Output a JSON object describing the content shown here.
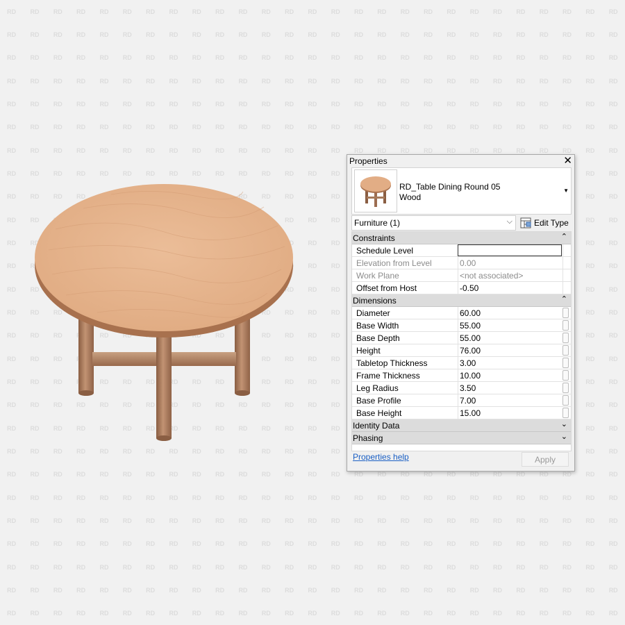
{
  "watermark_text": "RD",
  "properties_panel": {
    "title": "Properties",
    "close_glyph": "✕",
    "type_selector": {
      "name_line1": "RD_Table Dining Round 05",
      "name_line2": "Wood",
      "dropdown_glyph": "▼"
    },
    "instance_filter": {
      "value": "Furniture (1)",
      "dropdown_glyph": "⌵"
    },
    "edit_type_label": "Edit Type",
    "groups": [
      {
        "name": "Constraints",
        "toggle": "⌃",
        "rows": [
          {
            "name": "Schedule Level",
            "value": "",
            "enabled": true,
            "active": true
          },
          {
            "name": "Elevation from Level",
            "value": "0.00",
            "enabled": false
          },
          {
            "name": "Work Plane",
            "value": "<not associated>",
            "enabled": false
          },
          {
            "name": "Offset from Host",
            "value": "-0.50",
            "enabled": true
          }
        ]
      },
      {
        "name": "Dimensions",
        "toggle": "⌃",
        "rows": [
          {
            "name": "Diameter",
            "value": "60.00",
            "enabled": true,
            "param": true
          },
          {
            "name": "Base Width",
            "value": "55.00",
            "enabled": true,
            "param": true
          },
          {
            "name": "Base Depth",
            "value": "55.00",
            "enabled": true,
            "param": true
          },
          {
            "name": "Height",
            "value": "76.00",
            "enabled": true,
            "param": true
          },
          {
            "name": "Tabletop Thickness",
            "value": "3.00",
            "enabled": true,
            "param": true
          },
          {
            "name": "Frame Thickness",
            "value": "10.00",
            "enabled": true,
            "param": true
          },
          {
            "name": "Leg Radius",
            "value": "3.50",
            "enabled": true,
            "param": true
          },
          {
            "name": "Base Profile",
            "value": "7.00",
            "enabled": true,
            "param": true
          },
          {
            "name": "Base Height",
            "value": "15.00",
            "enabled": true,
            "param": true
          }
        ]
      },
      {
        "name": "Identity Data",
        "toggle": "⌄",
        "rows": []
      },
      {
        "name": "Phasing",
        "toggle": "⌄",
        "rows": []
      }
    ],
    "help_link": "Properties help",
    "apply_label": "Apply"
  },
  "colors": {
    "wood_top": "#e6b48c",
    "wood_edge": "#a8714e",
    "leg": "#a97a5b"
  }
}
